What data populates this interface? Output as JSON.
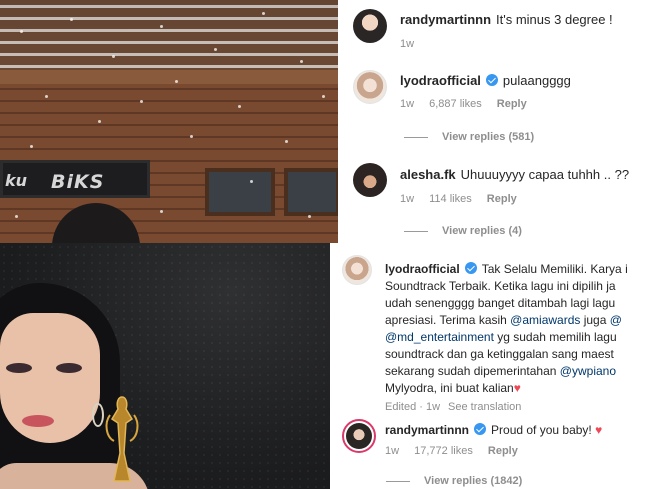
{
  "top_comments": {
    "randy": {
      "username": "randymartinnn",
      "text": "It's minus 3 degree !",
      "time": "1w"
    },
    "lyodra": {
      "username": "lyodraofficial",
      "text": "pulaangggg",
      "time": "1w",
      "likes": "6,887 likes",
      "reply_label": "Reply",
      "view_replies": "View replies (581)"
    },
    "alesha": {
      "username": "alesha.fk",
      "text": "Uhuuuyyyy capaa tuhhh .. ??",
      "time": "1w",
      "likes": "114 likes",
      "reply_label": "Reply",
      "view_replies": "View replies (4)"
    }
  },
  "caption": {
    "username": "lyodraofficial",
    "lines": [
      "Tak Selalu Memiliki. Karya i",
      "Soundtrack Terbaik. Ketika lagu ini dipilih ja",
      "udah senengggg banget ditambah lagi lagu",
      "apresiasi. Terima kasih",
      "yg sudah memilih lagu",
      "soundtrack dan ga ketinggalan sang maest",
      "sekarang sudah dipemerintahan",
      "Mylyodra, ini buat kalian"
    ],
    "mention_amiawards": "@amiawards",
    "juga": "juga",
    "mention_at": "@",
    "mention_md": "@md_entertainment",
    "mention_ywpiano": "@ywpiano",
    "heart": "♥",
    "edited": "Edited · 1w",
    "see_translation": "See translation"
  },
  "bottom_comment": {
    "username": "randymartinnn",
    "text": "Proud of you baby!",
    "heart": "♥",
    "time": "1w",
    "likes": "17,772 likes",
    "reply_label": "Reply",
    "view_replies": "View replies (1842)"
  },
  "photo_sign": {
    "left_text": "ku",
    "main_text": "BiKS"
  },
  "colors": {
    "verified": "#3897f0",
    "mention": "#00376b",
    "heart": "#ed4956",
    "story_ring": "#d93a6a"
  }
}
